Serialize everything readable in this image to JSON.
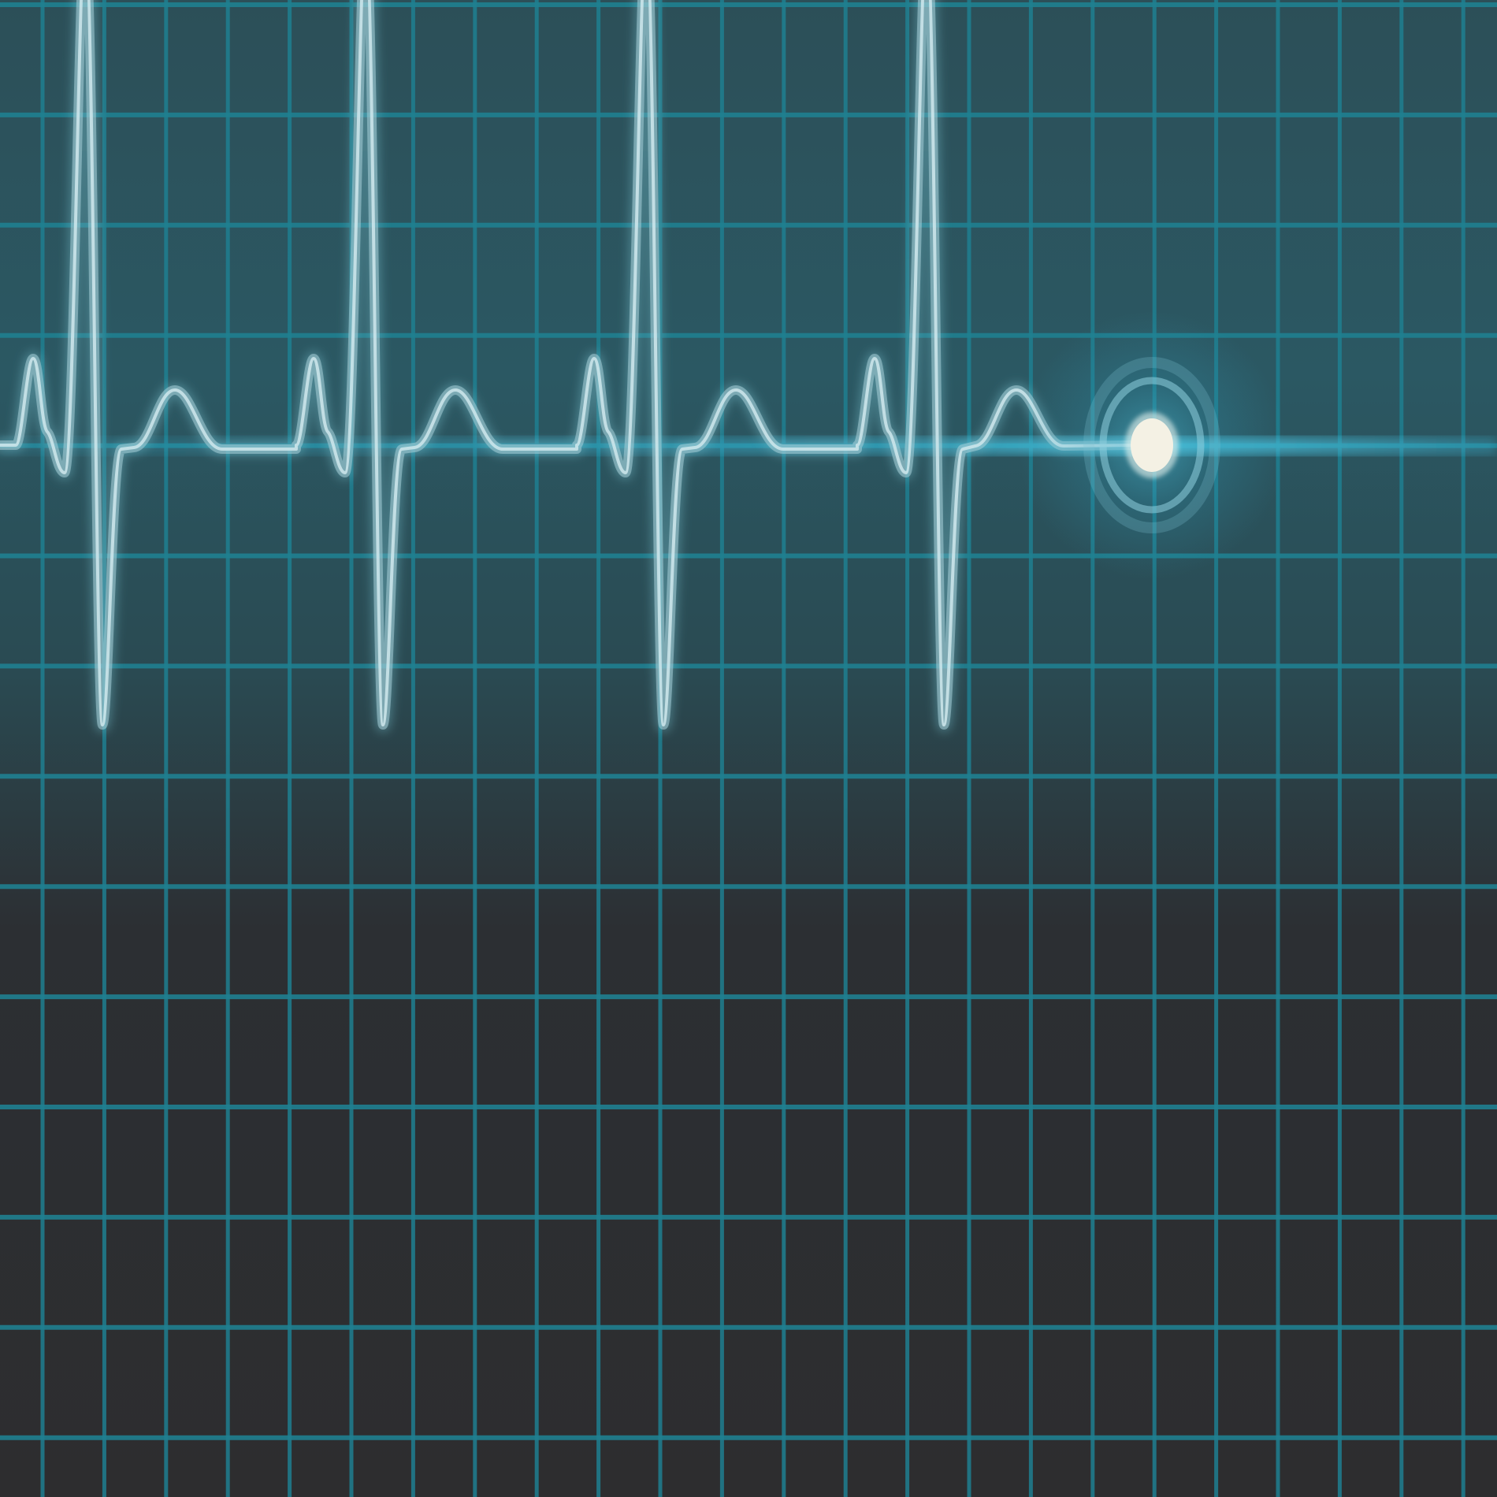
{
  "scene": {
    "subject": "heartbeat-monitor",
    "beats_visible": 4,
    "has_cursor_dot": true
  },
  "colors": {
    "background_top": "#2b5560",
    "background_bottom": "#2d2d2f",
    "grid_line": "#1f7f90",
    "trace": "#a8d0d8",
    "trace_glow": "#6fb3c2",
    "baseline_glow": "#3ab0cf",
    "cursor_dot": "#f4f1e4",
    "cursor_ring": "#7fc4d4"
  }
}
